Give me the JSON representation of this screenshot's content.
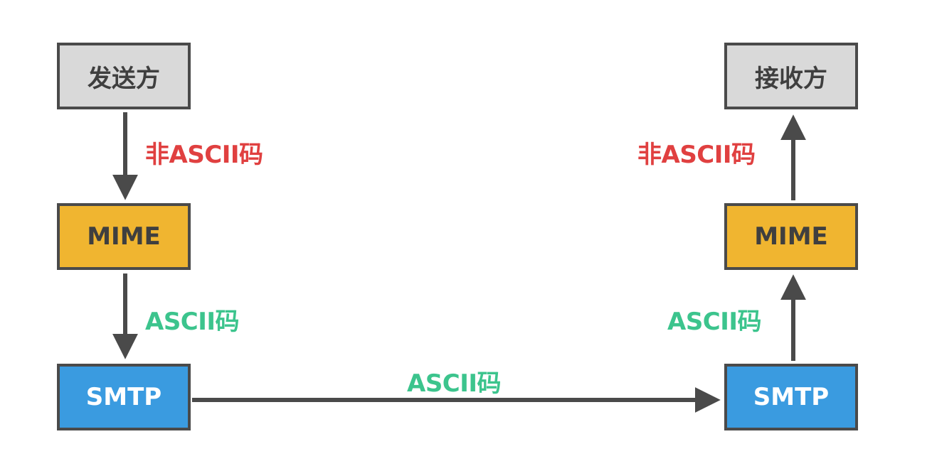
{
  "sender": {
    "title": "发送方",
    "mime": "MIME",
    "smtp": "SMTP",
    "label_top": "非ASCII码",
    "label_bottom": "ASCII码"
  },
  "receiver": {
    "title": "接收方",
    "mime": "MIME",
    "smtp": "SMTP",
    "label_top": "非ASCII码",
    "label_bottom": "ASCII码"
  },
  "transfer_label": "ASCII码",
  "colors": {
    "endpoint_fill": "#d9d9d9",
    "mime_fill": "#f0b530",
    "smtp_fill": "#3a9be0",
    "border": "#4a4a4a",
    "non_ascii_label": "#e04040",
    "ascii_label": "#3cc48d"
  }
}
